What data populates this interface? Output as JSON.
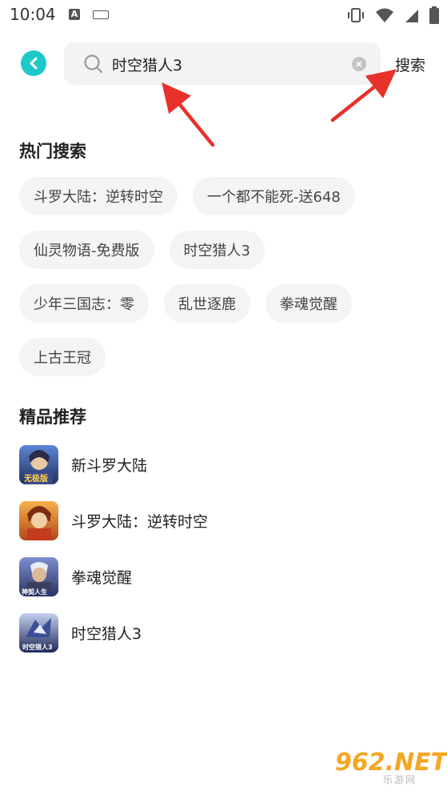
{
  "status_bar": {
    "time": "10:04",
    "a_badge": "A"
  },
  "header": {
    "search_value": "时空猎人3",
    "search_button": "搜索"
  },
  "hot": {
    "title": "热门搜索",
    "rows": [
      [
        "斗罗大陆：逆转时空",
        "一个都不能死-送648"
      ],
      [
        "仙灵物语-免费版",
        "时空猎人3"
      ],
      [
        "少年三国志：零",
        "乱世逐鹿",
        "拳魂觉醒"
      ],
      [
        "上古王冠"
      ]
    ]
  },
  "recommend": {
    "title": "精品推荐",
    "items": [
      {
        "name": "新斗罗大陆",
        "icon": "game-icon-new-douluo",
        "colors": [
          "#3b5fa8",
          "#c9a45c"
        ],
        "icon_text": "无极版"
      },
      {
        "name": "斗罗大陆：逆转时空",
        "icon": "game-icon-douluo-reverse",
        "colors": [
          "#e88a2a",
          "#7a3b1a"
        ],
        "icon_text": ""
      },
      {
        "name": "拳魂觉醒",
        "icon": "game-icon-quanhun",
        "colors": [
          "#4a5f9e",
          "#d8dbe6"
        ],
        "icon_text": "神契人生"
      },
      {
        "name": "时空猎人3",
        "icon": "game-icon-shikong-lieren",
        "colors": [
          "#2f3f7a",
          "#a9b6e6"
        ],
        "icon_text": "时空猎人3"
      }
    ]
  },
  "watermark": {
    "big": "962.NET",
    "small": "乐游网"
  }
}
